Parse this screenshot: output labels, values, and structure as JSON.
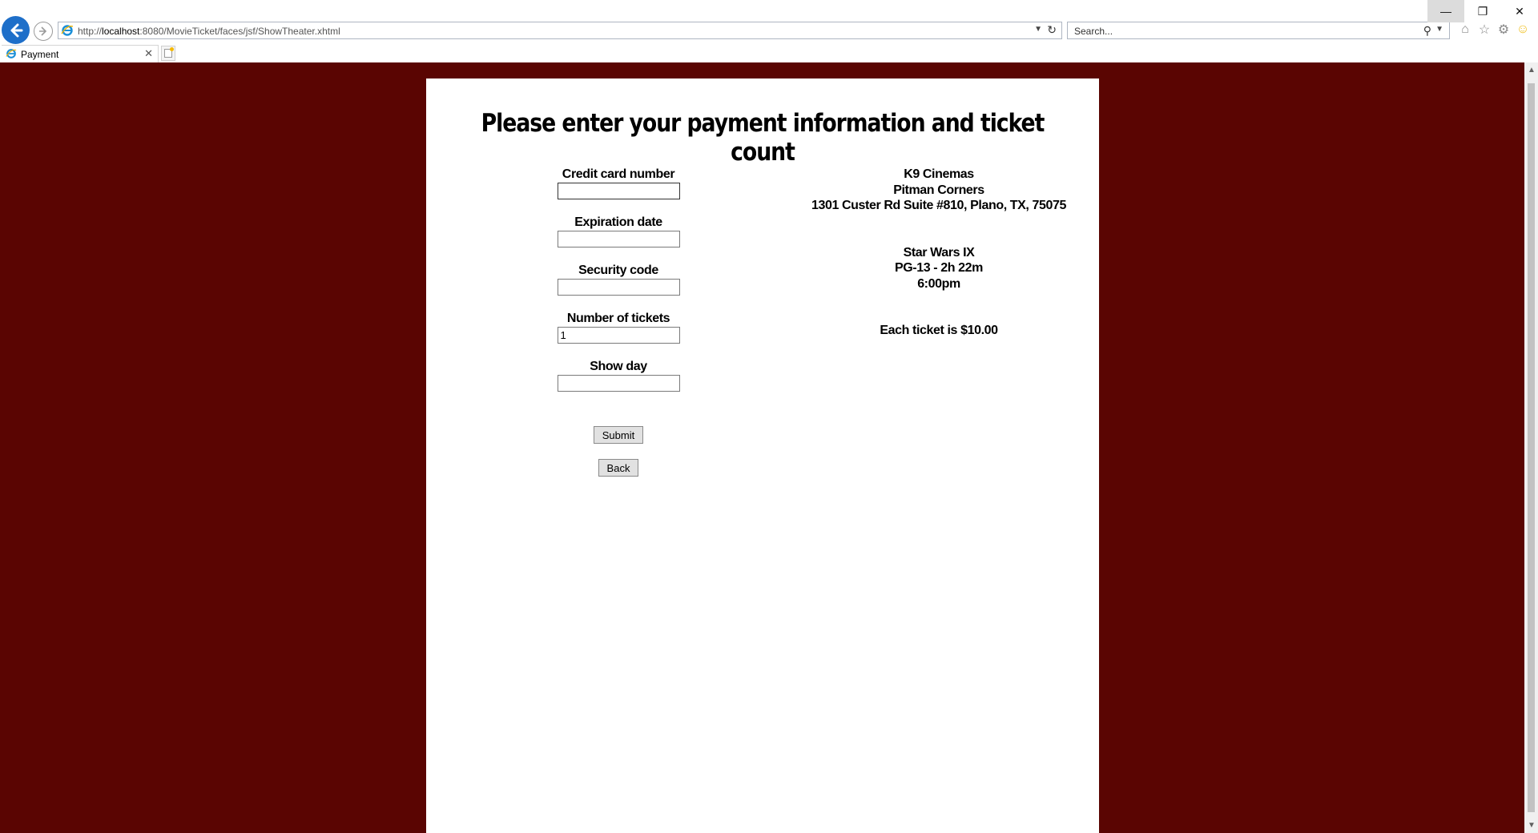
{
  "browser": {
    "url_prefix": "http://",
    "url_host": "localhost",
    "url_rest": ":8080/MovieTicket/faces/jsf/ShowTheater.xhtml",
    "search_placeholder": "Search...",
    "tab_title": "Payment",
    "colors": {
      "back_button": "#1e6fc9",
      "page_background": "#5a0502"
    }
  },
  "page": {
    "heading": "Please enter your payment information and ticket count",
    "form": {
      "credit_card_label": "Credit card number",
      "credit_card_value": "",
      "expiration_label": "Expiration date",
      "expiration_value": "",
      "security_label": "Security code",
      "security_value": "",
      "tickets_label": "Number of tickets",
      "tickets_value": "1",
      "show_day_label": "Show day",
      "show_day_value": "",
      "submit_label": "Submit",
      "back_label": "Back"
    },
    "theater": {
      "name": "K9 Cinemas",
      "location": "Pitman Corners",
      "address": "1301 Custer Rd Suite #810, Plano, TX, 75075"
    },
    "movie": {
      "title": "Star Wars IX",
      "rating_runtime": "PG-13 - 2h 22m",
      "showtime": "6:00pm"
    },
    "price_text": "Each ticket is $10.00"
  }
}
